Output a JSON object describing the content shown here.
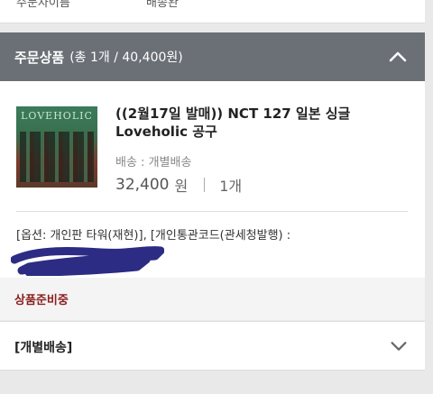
{
  "top_card": {
    "label": "주문자이름",
    "value": "배송완"
  },
  "section": {
    "title": "주문상품",
    "summary": "(총 1개 / 40,400원)"
  },
  "product": {
    "album_word": "LOVEHOLIC",
    "title": "((2월17일 발매)) NCT 127 일본 싱글 Loveholic 공구",
    "shipping_label": "배송 : ",
    "shipping_value": "개별배송",
    "price": "32,400",
    "currency": "원",
    "quantity": "1개",
    "options": "[옵션: 개인판 타워(재현)], [개인통관코드(관세청발행) :"
  },
  "status": "상품준비중",
  "shipping_section": {
    "label": "[개별배송]"
  },
  "colors": {
    "header_bg": "#6b6f76",
    "status_red": "#8a1e1e",
    "scribble_blue": "#1a1a7a"
  }
}
